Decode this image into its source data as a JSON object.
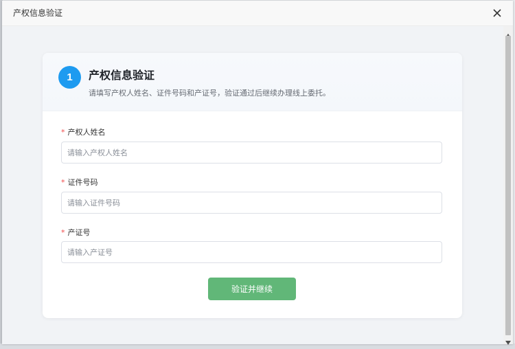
{
  "window": {
    "title": "产权信息验证"
  },
  "card": {
    "step_number": "1",
    "title": "产权信息验证",
    "subtitle": "请填写产权人姓名、证件号码和产证号，验证通过后继续办理线上委托。"
  },
  "form": {
    "required_mark": "*",
    "fields": [
      {
        "label": "产权人姓名",
        "value": "",
        "placeholder": "请输入产权人姓名"
      },
      {
        "label": "证件号码",
        "value": "",
        "placeholder": "请输入证件号码"
      },
      {
        "label": "产证号",
        "value": "",
        "placeholder": "请输入产证号"
      }
    ],
    "submit_label": "验证并继续"
  },
  "colors": {
    "accent_blue": "#1e9bf0",
    "submit_green": "#61b778",
    "required_red": "#f04b4b"
  },
  "icons": {
    "close": "close-icon",
    "scroll_up": "triangle-up-icon",
    "scroll_down": "triangle-down-icon"
  }
}
